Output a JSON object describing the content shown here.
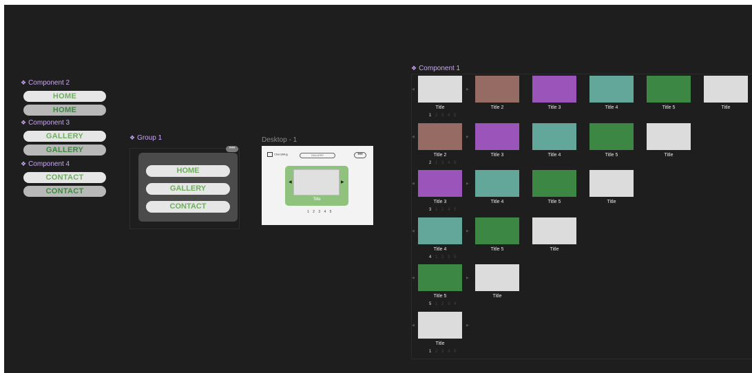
{
  "canvas_labels": {
    "component2": "Component 2",
    "component3": "Component 3",
    "component4": "Component 4",
    "group1": "Group 1",
    "desktop1": "Desktop - 1",
    "component1": "Component 1"
  },
  "components": {
    "home_label": "HOME",
    "gallery_label": "GALLERY",
    "contact_label": "CONTACT"
  },
  "group": {
    "dots": "•••",
    "items": [
      "HOME",
      "GALLERY",
      "CONTACT"
    ]
  },
  "desktop": {
    "logo_text": "CherryMug",
    "search_text": "GALLERY",
    "dots": "•••",
    "card_title": "Title",
    "left_arrow": "◀",
    "right_arrow": "▶",
    "pagination": "1 2 3 4 5"
  },
  "colors": {
    "light": "#dcdcdc",
    "brown": "#966b64",
    "purple": "#9b54b9",
    "teal": "#62a79a",
    "green": "#3d8744"
  },
  "variants": [
    {
      "items": [
        {
          "title": "Title",
          "color": "light"
        },
        {
          "title": "Title 2",
          "color": "brown"
        },
        {
          "title": "Title 3",
          "color": "purple"
        },
        {
          "title": "Title 4",
          "color": "teal"
        },
        {
          "title": "Title 5",
          "color": "green"
        },
        {
          "title": "Title",
          "color": "light"
        }
      ],
      "pager_current": "1",
      "pager_rest": " 2 3 4 5"
    },
    {
      "items": [
        {
          "title": "Title 2",
          "color": "brown"
        },
        {
          "title": "Title 3",
          "color": "purple"
        },
        {
          "title": "Title 4",
          "color": "teal"
        },
        {
          "title": "Title 5",
          "color": "green"
        },
        {
          "title": "Title",
          "color": "light"
        }
      ],
      "pager_current": "2",
      "pager_rest": "1 3 4 5"
    },
    {
      "items": [
        {
          "title": "Title 3",
          "color": "purple"
        },
        {
          "title": "Title 4",
          "color": "teal"
        },
        {
          "title": "Title 5",
          "color": "green"
        },
        {
          "title": "Title",
          "color": "light"
        }
      ],
      "pager_current": "3",
      "pager_rest": "1 2 4 5"
    },
    {
      "items": [
        {
          "title": "Title 4",
          "color": "teal"
        },
        {
          "title": "Title 5",
          "color": "green"
        },
        {
          "title": "Title",
          "color": "light"
        }
      ],
      "pager_current": "4",
      "pager_rest": "1 2 3 5"
    },
    {
      "items": [
        {
          "title": "Title 5",
          "color": "green"
        },
        {
          "title": "Title",
          "color": "light"
        }
      ],
      "pager_current": "5",
      "pager_rest": "1 2 3 4"
    },
    {
      "items": [
        {
          "title": "Title",
          "color": "light"
        }
      ],
      "pager_current": "1",
      "pager_rest": " 2 3 4 5"
    }
  ]
}
